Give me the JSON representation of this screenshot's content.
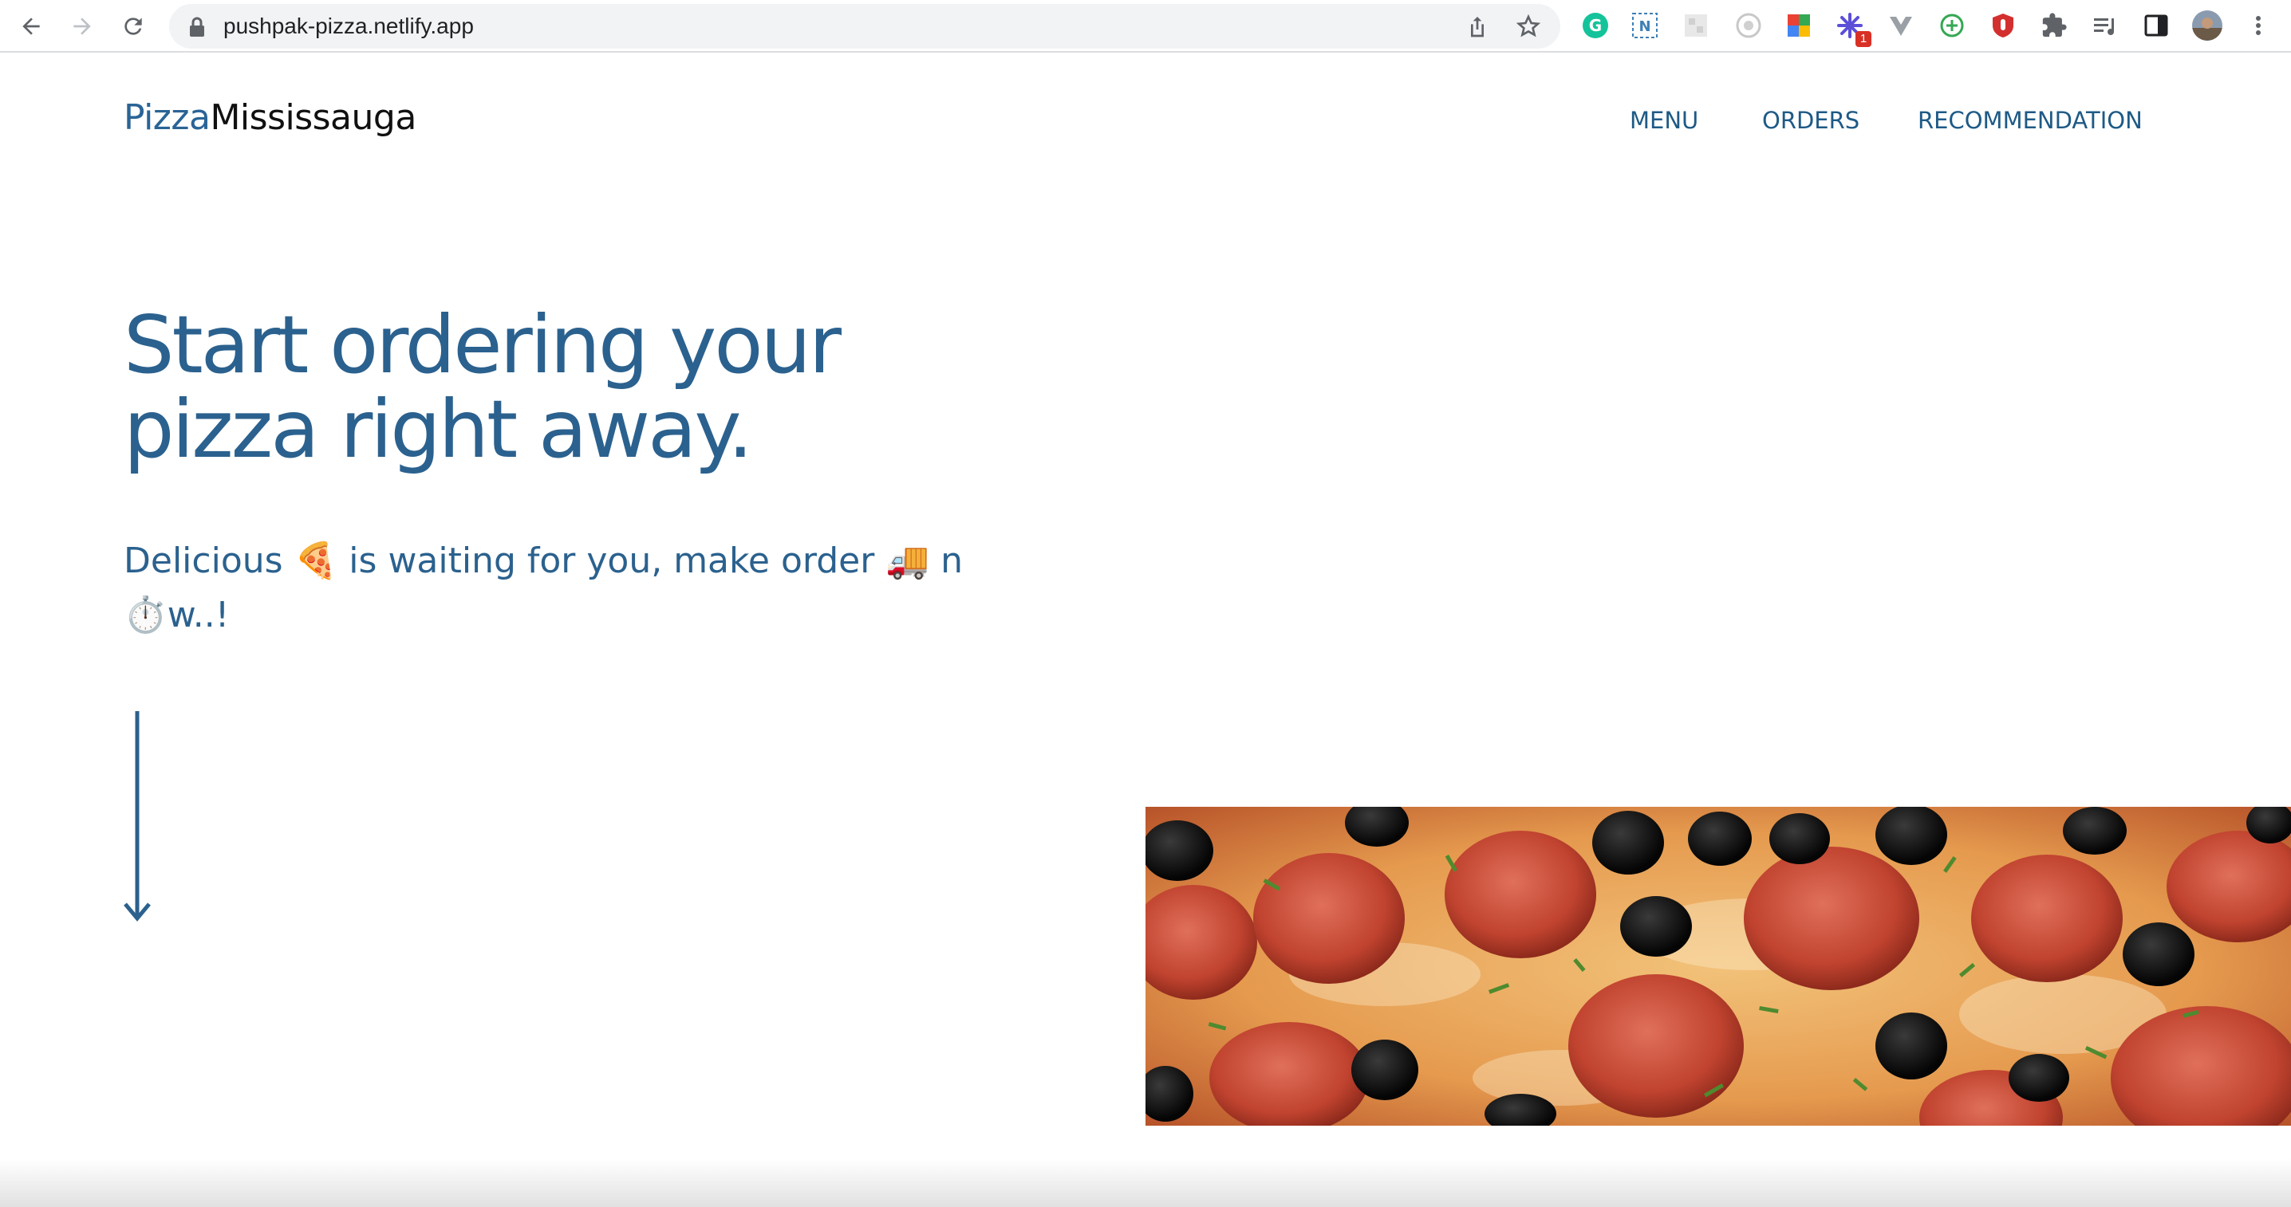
{
  "browser": {
    "url": "pushpak-pizza.netlify.app",
    "extension_badge": "1",
    "icons": [
      "back-icon",
      "forward-icon",
      "reload-icon",
      "lock-icon",
      "share-icon",
      "bookmark-star-icon",
      "grammarly-icon",
      "notion-web-clipper-icon",
      "extension-grid-icon",
      "extension-target-icon",
      "extension-colorful-icon",
      "extension-flower-icon",
      "vue-devtools-icon",
      "extension-plus-circle-icon",
      "ublock-icon",
      "extensions-puzzle-icon",
      "reading-list-icon",
      "side-panel-icon",
      "profile-avatar",
      "chrome-menu-icon"
    ]
  },
  "site": {
    "logo_part1": "Pizza",
    "logo_part2": "Mississauga",
    "nav": {
      "menu": "MENU",
      "orders": "ORDERS",
      "recommendation": "RECOMMENDATION"
    }
  },
  "hero": {
    "title": "Start ordering your pizza right away.",
    "subtitle": "Delicious 🍕 is waiting for you, make order 🚚 n⏱️w..!"
  },
  "colors": {
    "brand_blue": "#2b618e",
    "nav_blue": "#1e5a86",
    "logo_dark": "#111111",
    "chrome_bg": "#f1f3f4"
  }
}
